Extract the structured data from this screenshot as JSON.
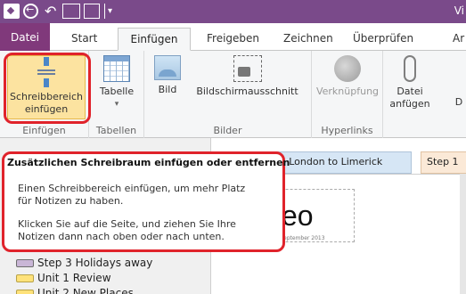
{
  "window": {
    "title_fragment": "Vi"
  },
  "ribbon_tabs": [
    "Datei",
    "Start",
    "Einfügen",
    "Freigeben",
    "Zeichnen",
    "Überprüfen",
    "Ar"
  ],
  "ribbon": {
    "groups": {
      "einfuegen": "Einfügen",
      "tabellen": "Tabellen",
      "bilder": "Bilder",
      "hyperlinks": "Hyperlinks"
    },
    "buttons": {
      "schreibbereich_line1": "Schreibbereich",
      "schreibbereich_line2": "einfügen",
      "tabelle": "Tabelle",
      "tabelle_arrow": "▾",
      "bild": "Bild",
      "bildschirmausschnitt": "Bildschirmausschnitt",
      "verknuepfung": "Verknüpfung",
      "datei_line1": "Datei",
      "datei_line2": "anfügen",
      "more": "D"
    }
  },
  "tooltip": {
    "title": "Zusätzlichen Schreibraum einfügen oder entfernen",
    "para1_line1": "Einen Schreibbereich einfügen, um mehr Platz",
    "para1_line2": "für Notizen zu haben.",
    "para2_line1": "Klicken Sie auf die Seite, und ziehen Sie Ihre",
    "para2_line2": "Notizen dann nach oben oder nach unten."
  },
  "page_tabs": [
    "rom London to Limerick",
    "Step 1"
  ],
  "note": {
    "title": "eo",
    "date": "eptember 2013"
  },
  "sections": [
    "Step 3 Holidays away",
    "Unit 1 Review",
    "Unit 2 New Places"
  ]
}
